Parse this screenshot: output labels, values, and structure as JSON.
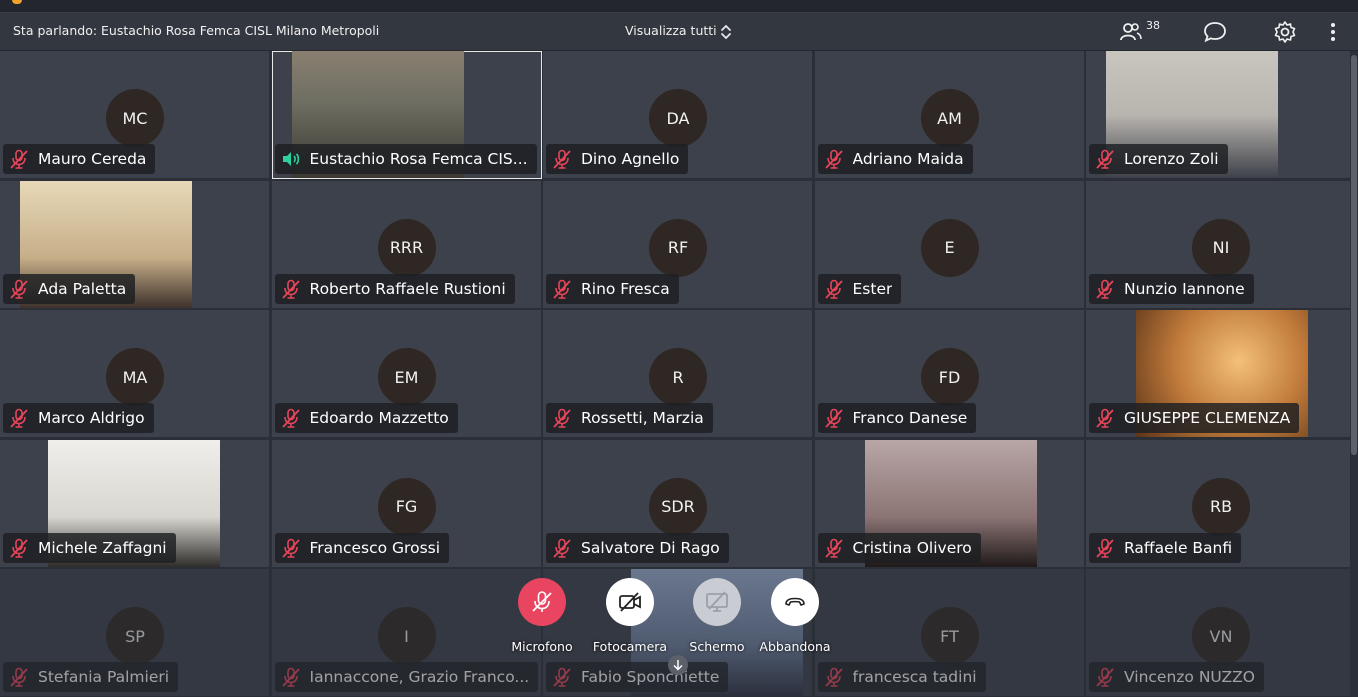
{
  "topbar": {
    "speaking": "Sta parlando: Eustachio Rosa Femca CISL Milano Metropoli",
    "view_all": "Visualizza tutti",
    "participant_count": "38",
    "icons": [
      "participants-icon",
      "chat-icon",
      "settings-icon",
      "more-vertical-icon"
    ]
  },
  "tiles": [
    {
      "name": "Mauro Cereda",
      "initials": "MC",
      "video": false,
      "mic": "muted"
    },
    {
      "name": "Eustachio Rosa Femca CIS...",
      "initials": "",
      "video": true,
      "mic": "speaking"
    },
    {
      "name": "Dino Agnello",
      "initials": "DA",
      "video": false,
      "mic": "muted"
    },
    {
      "name": "Adriano Maida",
      "initials": "AM",
      "video": false,
      "mic": "muted"
    },
    {
      "name": "Lorenzo Zoli",
      "initials": "",
      "video": true,
      "mic": "muted"
    },
    {
      "name": "Ada Paletta",
      "initials": "",
      "video": true,
      "mic": "muted"
    },
    {
      "name": "Roberto Raffaele Rustioni",
      "initials": "RRR",
      "video": false,
      "mic": "muted"
    },
    {
      "name": "Rino Fresca",
      "initials": "RF",
      "video": false,
      "mic": "muted"
    },
    {
      "name": "Ester",
      "initials": "E",
      "video": false,
      "mic": "muted"
    },
    {
      "name": "Nunzio Iannone",
      "initials": "NI",
      "video": false,
      "mic": "muted"
    },
    {
      "name": "Marco Aldrigo",
      "initials": "MA",
      "video": false,
      "mic": "muted"
    },
    {
      "name": "Edoardo Mazzetto",
      "initials": "EM",
      "video": false,
      "mic": "muted"
    },
    {
      "name": "Rossetti, Marzia",
      "initials": "R",
      "video": false,
      "mic": "muted"
    },
    {
      "name": "Franco Danese",
      "initials": "FD",
      "video": false,
      "mic": "muted"
    },
    {
      "name": "GIUSEPPE CLEMENZA",
      "initials": "",
      "video": true,
      "mic": "muted"
    },
    {
      "name": "Michele Zaffagni",
      "initials": "",
      "video": true,
      "mic": "muted"
    },
    {
      "name": "Francesco Grossi",
      "initials": "FG",
      "video": false,
      "mic": "muted"
    },
    {
      "name": "Salvatore Di Rago",
      "initials": "SDR",
      "video": false,
      "mic": "muted"
    },
    {
      "name": "Cristina Olivero",
      "initials": "",
      "video": true,
      "mic": "muted"
    },
    {
      "name": "Raffaele Banfi",
      "initials": "RB",
      "video": false,
      "mic": "muted"
    },
    {
      "name": "Stefania Palmieri",
      "initials": "SP",
      "video": false,
      "mic": "muted"
    },
    {
      "name": "Iannaccone, Grazio Franco...",
      "initials": "I",
      "video": false,
      "mic": "muted"
    },
    {
      "name": "Fabio Sponchiette",
      "initials": "",
      "video": true,
      "mic": "muted"
    },
    {
      "name": "francesca tadini",
      "initials": "FT",
      "video": false,
      "mic": "muted"
    },
    {
      "name": "Vincenzo NUZZO",
      "initials": "VN",
      "video": false,
      "mic": "muted"
    }
  ],
  "controls": {
    "microphone": "Microfono",
    "camera": "Fotocamera",
    "screen": "Schermo",
    "leave": "Abbandona"
  },
  "colors": {
    "mic_muted": "#e8455a",
    "speaking": "#2fd0a0",
    "tile_bg": "#3c414b",
    "avatar_bg": "#2e2723",
    "leave_btn": "#ffffff",
    "mic_btn": "#e94560"
  }
}
